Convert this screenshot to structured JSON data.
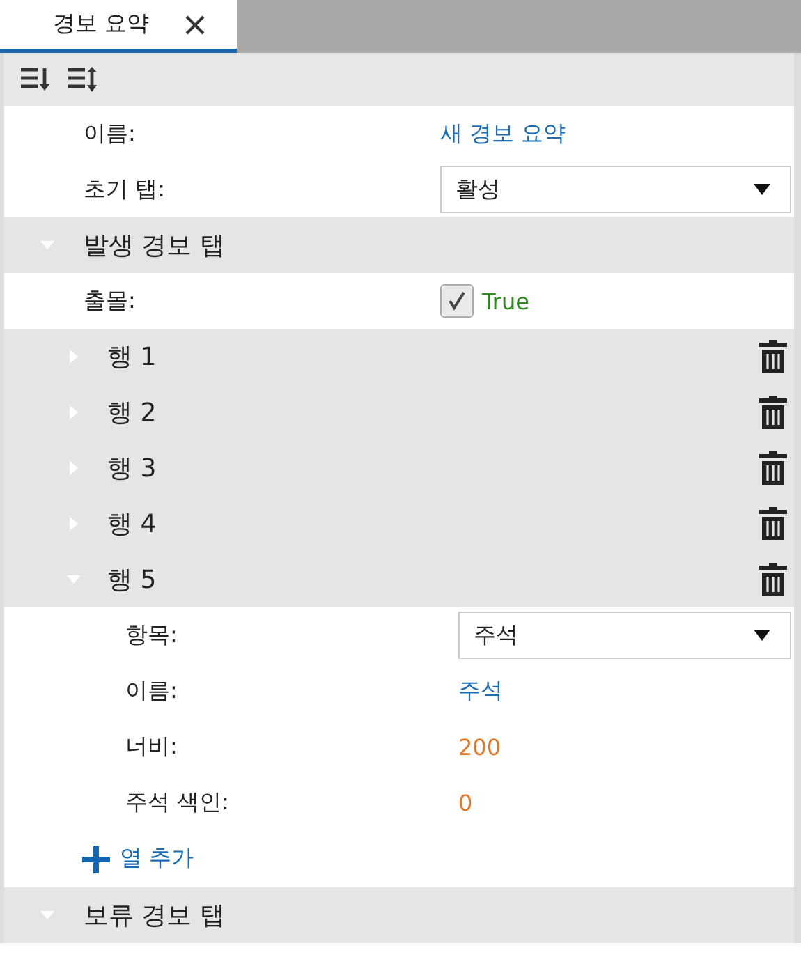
{
  "tab": {
    "label": "경보 요약"
  },
  "properties": [
    {
      "label": "이름:",
      "kind": "link",
      "value": "새 경보 요약"
    },
    {
      "label": "초기 탭:",
      "kind": "dropdown",
      "value": "활성"
    }
  ],
  "sections": [
    {
      "title": "발생 경보 탭",
      "expanded": true,
      "properties": [
        {
          "label": "출몰:",
          "kind": "checkbox",
          "checked": true,
          "value": "True"
        }
      ],
      "rows": [
        {
          "label": "행 1",
          "expanded": false,
          "properties": []
        },
        {
          "label": "행 2",
          "expanded": false,
          "properties": []
        },
        {
          "label": "행 3",
          "expanded": false,
          "properties": []
        },
        {
          "label": "행 4",
          "expanded": false,
          "properties": []
        },
        {
          "label": "행 5",
          "expanded": true,
          "properties": [
            {
              "label": "항목:",
              "kind": "dropdown",
              "value": "주석"
            },
            {
              "label": "이름:",
              "kind": "link",
              "value": "주석"
            },
            {
              "label": "너비:",
              "kind": "number",
              "value": "200"
            },
            {
              "label": "주석 색인:",
              "kind": "number",
              "value": "0"
            }
          ]
        }
      ],
      "add_label": "열 추가"
    },
    {
      "title": "보류 경보 탭",
      "expanded": true
    }
  ]
}
